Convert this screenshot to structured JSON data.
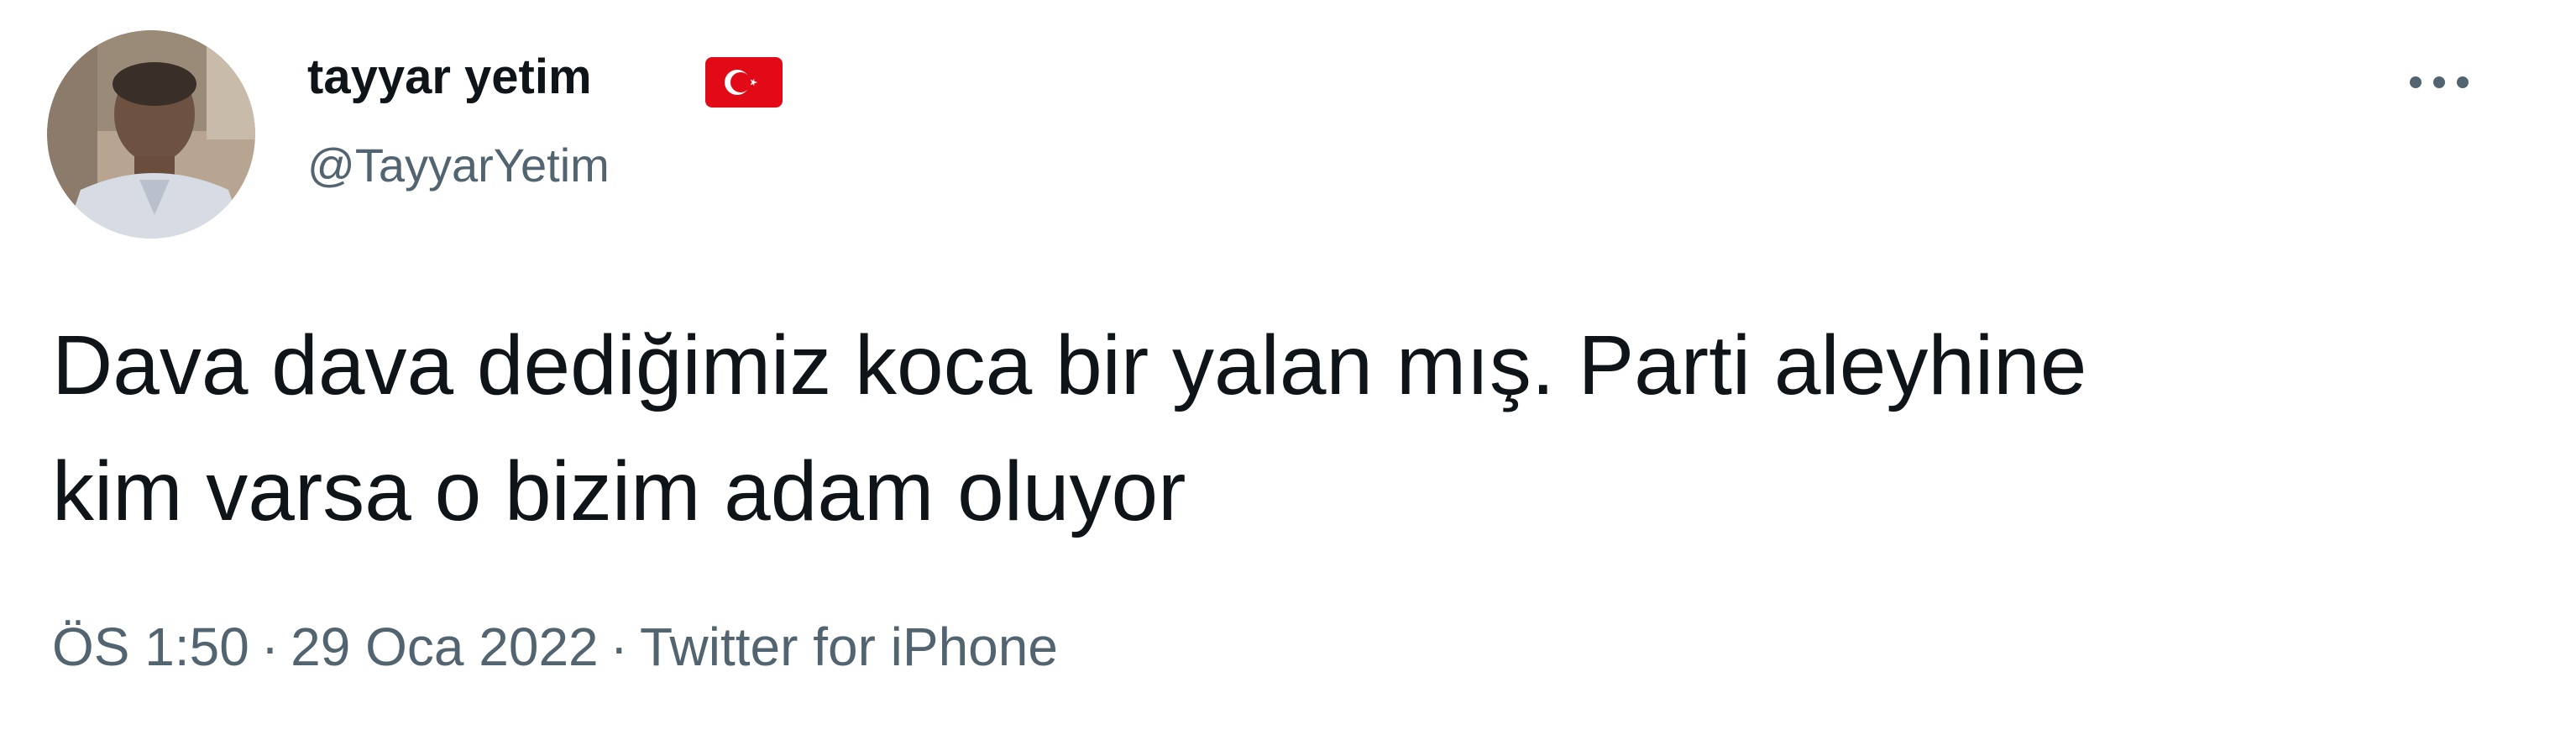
{
  "user": {
    "display_name": "tayyar yetim",
    "handle": "@TayyarYetim",
    "flag_icon": "turkey-flag-icon",
    "avatar_icon": "profile-photo"
  },
  "tweet": {
    "lines": [
      "Dava dava dediğimiz koca bir yalan mış. Parti aleyhine",
      "kim varsa o bizim adam oluyor"
    ]
  },
  "meta": {
    "time": "ÖS 1:50",
    "separator": "·",
    "date": "29 Oca 2022",
    "source": "Twitter for iPhone"
  },
  "more_icon": "more-options-icon",
  "colors": {
    "text": "#0f1419",
    "secondary": "#536471",
    "flag_red": "#e30a17"
  }
}
